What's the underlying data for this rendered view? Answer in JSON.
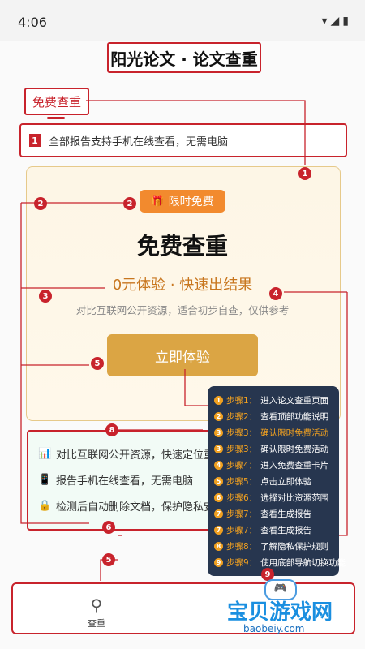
{
  "status_bar": {
    "time": "4:06",
    "icons": "▾◢▮"
  },
  "page_title": "阳光论文 · 论文查重",
  "tab": {
    "label": "免费查重"
  },
  "notice": {
    "number": "1",
    "text": "全部报告支持手机在线查看，无需电脑"
  },
  "card": {
    "badge": "限时免费",
    "badge_icon": "gift-icon",
    "title": "免费查重",
    "subtitle": "0元体验 · 快速出结果",
    "description": "对比互联网公开资源，适合初步自查，仅供参考",
    "cta": "立即体验"
  },
  "features": [
    {
      "icon": "📊",
      "text": "对比互联网公开资源，快速定位重复内容"
    },
    {
      "icon": "📱",
      "text": "报告手机在线查看，无需电脑"
    },
    {
      "icon": "🔒",
      "text": "检测后自动删除文档，保护隐私安全"
    }
  ],
  "steps": [
    {
      "n": "1",
      "label": "步骤1：",
      "text": "进入论文查重页面"
    },
    {
      "n": "2",
      "label": "步骤2：",
      "text": "查看顶部功能说明"
    },
    {
      "n": "3",
      "label": "步骤3：",
      "text": "确认限时免费活动"
    },
    {
      "n": "3",
      "label": "步骤3：",
      "text": "确认限时免费活动"
    },
    {
      "n": "4",
      "label": "步骤4：",
      "text": "进入免费查重卡片"
    },
    {
      "n": "5",
      "label": "步骤5：",
      "text": "点击立即体验"
    },
    {
      "n": "6",
      "label": "步骤6：",
      "text": "选择对比资源范围"
    },
    {
      "n": "7",
      "label": "步骤7：",
      "text": "查看生成报告"
    },
    {
      "n": "7",
      "label": "步骤7：",
      "text": "查看生成报告"
    },
    {
      "n": "8",
      "label": "步骤8：",
      "text": "了解隐私保护规则"
    },
    {
      "n": "9",
      "label": "步骤9：",
      "text": "使用底部导航切换功能"
    }
  ],
  "markers": [
    "1",
    "2",
    "2",
    "3",
    "4",
    "5",
    "8",
    "6",
    "5",
    "9"
  ],
  "bottom_nav": {
    "search_label": "查重"
  },
  "watermark": {
    "text": "宝贝游戏网",
    "url": "baobeiy.com"
  },
  "colors": {
    "accent_red": "#c8232c",
    "cta_gold": "#dba544",
    "badge_orange": "#f28a2e",
    "steps_bg": "#27364f"
  }
}
